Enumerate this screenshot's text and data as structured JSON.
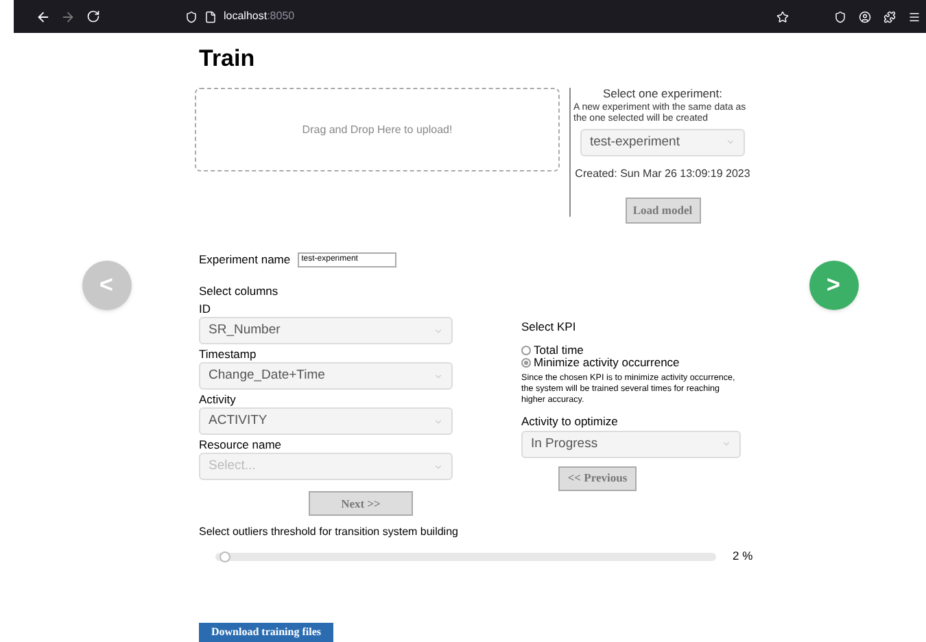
{
  "browser": {
    "url_host": "localhost",
    "url_port": ":8050"
  },
  "nav": {
    "previous": "<",
    "next": ">"
  },
  "title": "Train",
  "upload": {
    "text": "Drag and Drop Here to upload!"
  },
  "experiment_select": {
    "heading": "Select one experiment:",
    "note": "A new experiment with the same data as the one selected will be created",
    "value": "test-experiment",
    "created": "Created: Sun Mar 26 13:09:19 2023",
    "button": "Load model"
  },
  "experiment_name": {
    "label": "Experiment name",
    "value": "test-experiment"
  },
  "columns": {
    "heading": "Select columns",
    "fields": [
      {
        "label": "ID",
        "value": "SR_Number"
      },
      {
        "label": "Timestamp",
        "value": "Change_Date+Time"
      },
      {
        "label": "Activity",
        "value": "ACTIVITY"
      },
      {
        "label": "Resource name",
        "placeholder": "Select..."
      }
    ],
    "next_button": "Next >>"
  },
  "kpi": {
    "heading": "Select KPI",
    "options": [
      {
        "label": "Total time",
        "selected": false
      },
      {
        "label": "Minimize activity occurrence",
        "selected": true
      }
    ],
    "note": "Since the chosen KPI is to minimize activity occurrence, the system will be trained several times for reaching higher accuracy.",
    "activity_label": "Activity to optimize",
    "activity_value": "In Progress",
    "previous_button": "<< Previous"
  },
  "threshold": {
    "label": "Select outliers threshold for transition system building",
    "level": 0.02,
    "reading": "2 %"
  },
  "download_button": "Download training files"
}
